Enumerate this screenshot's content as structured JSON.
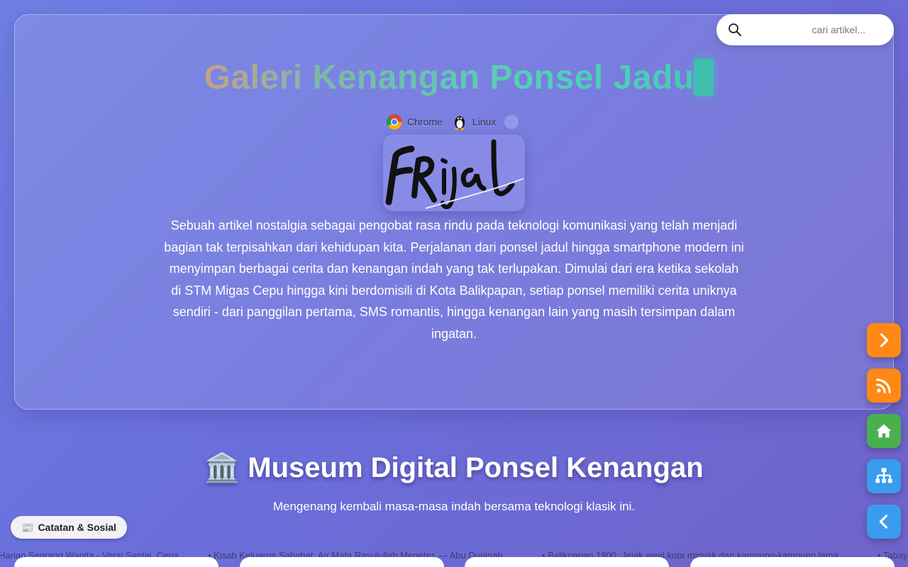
{
  "search": {
    "placeholder": "cari artikel...",
    "icon": "search-icon"
  },
  "hero": {
    "title": "Galeri Kenangan Ponsel Jadul",
    "badges": [
      {
        "label": "Chrome",
        "icon": "chrome-icon"
      },
      {
        "label": "Linux",
        "icon": "linux-tux-icon"
      }
    ],
    "signature_text": "FRijal",
    "description": "Sebuah artikel nostalgia sebagai pengobat rasa rindu pada teknologi komunikasi yang telah menjadi bagian tak terpisahkan dari kehidupan kita. Perjalanan dari ponsel jadul hingga smartphone modern ini menyimpan berbagai cerita dan kenangan indah yang tak terlupakan. Dimulai dari era ketika sekolah di STM Migas Cepu hingga kini berdomisili di Kota Balikpapan, setiap ponsel memiliki cerita uniknya sendiri - dari panggilan pertama, SMS romantis, hingga kenangan lain yang masih tersimpan dalam ingatan."
  },
  "museum": {
    "emoji": "🏛️",
    "title": "Museum Digital Ponsel Kenangan",
    "subtitle": "Mengenang kembali masa-masa indah bersama teknologi klasik ini."
  },
  "notes_pill": {
    "emoji": "📰",
    "label": "Catatan & Sosial"
  },
  "ticker": [
    "Harian Seorang Wanita - Versi Santai, Ceria",
    "• Kisah Keluarga Sahabat: Air Mata Rasulullah Menetes — Abu Dujanah",
    "• Balikpapan 1900: Jejak awal kota minyak dan kampung-kampung lama",
    "• Tabay"
  ],
  "fabs": [
    {
      "name": "next-button",
      "icon": "chevron-right-icon",
      "color": "#ff8a1c"
    },
    {
      "name": "rss-button",
      "icon": "rss-icon",
      "color": "#ff8a1c"
    },
    {
      "name": "home-button",
      "icon": "home-icon",
      "color": "#4caf50"
    },
    {
      "name": "sitemap-button",
      "icon": "sitemap-icon",
      "color": "#3d9be9"
    },
    {
      "name": "back-button",
      "icon": "chevron-left-icon",
      "color": "#3d9be9"
    }
  ]
}
